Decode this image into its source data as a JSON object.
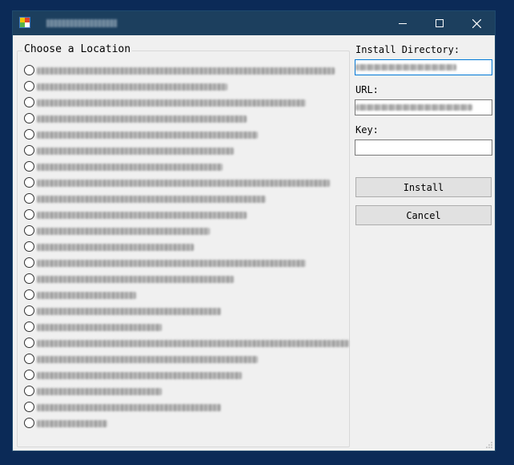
{
  "window": {
    "title": "",
    "controls": {
      "minimize": "minimize",
      "maximize": "maximize",
      "close": "close"
    }
  },
  "location_group": {
    "legend": "Choose a Location",
    "options_note": "option labels are blurred/redacted in the screenshot",
    "options": [
      {
        "label": "",
        "selected": false
      },
      {
        "label": "",
        "selected": false
      },
      {
        "label": "",
        "selected": false
      },
      {
        "label": "",
        "selected": false
      },
      {
        "label": "",
        "selected": false
      },
      {
        "label": "",
        "selected": false
      },
      {
        "label": "",
        "selected": false
      },
      {
        "label": "",
        "selected": false
      },
      {
        "label": "",
        "selected": false
      },
      {
        "label": "",
        "selected": false
      },
      {
        "label": "",
        "selected": false
      },
      {
        "label": "",
        "selected": false
      },
      {
        "label": "",
        "selected": false
      },
      {
        "label": "",
        "selected": false
      },
      {
        "label": "",
        "selected": false
      },
      {
        "label": "",
        "selected": false
      },
      {
        "label": "",
        "selected": false
      },
      {
        "label": "",
        "selected": false
      },
      {
        "label": "",
        "selected": false
      },
      {
        "label": "",
        "selected": false
      },
      {
        "label": "",
        "selected": false
      },
      {
        "label": "",
        "selected": false
      },
      {
        "label": "",
        "selected": false
      }
    ]
  },
  "form": {
    "install_dir_label": "Install Directory:",
    "install_dir_value": "",
    "url_label": "URL:",
    "url_value": "",
    "key_label": "Key:",
    "key_value": "",
    "install_button": "Install",
    "cancel_button": "Cancel"
  },
  "colors": {
    "desktop": "#0b2a57",
    "titlebar": "#1c3f5e",
    "window_bg": "#f0f0f0",
    "focus_border": "#0078d7"
  }
}
